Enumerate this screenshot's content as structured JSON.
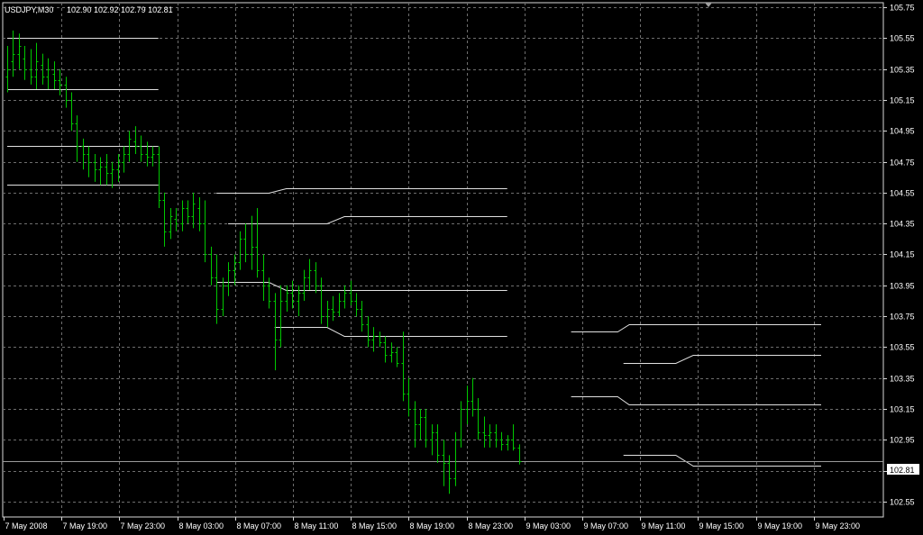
{
  "chart_data": {
    "type": "ohlc",
    "title": "USDJPY,M30",
    "ohlc_header": [
      "102.90",
      "102.92",
      "102.79",
      "102.81"
    ],
    "current_price": "102.81",
    "ylim": [
      102.45,
      105.78
    ],
    "yticks": [
      "105.75",
      "105.55",
      "105.35",
      "105.15",
      "104.95",
      "104.75",
      "104.55",
      "104.35",
      "104.15",
      "103.95",
      "103.75",
      "103.55",
      "103.35",
      "103.15",
      "102.95",
      "102.75",
      "102.55"
    ],
    "xticks": [
      "7 May 2008",
      "7 May 19:00",
      "7 May 23:00",
      "8 May 03:00",
      "8 May 07:00",
      "8 May 11:00",
      "8 May 15:00",
      "8 May 19:00",
      "8 May 23:00",
      "9 May 03:00",
      "9 May 07:00",
      "9 May 11:00",
      "9 May 15:00",
      "9 May 19:00",
      "9 May 23:00"
    ],
    "grid": true,
    "colors": {
      "background": "#000000",
      "grid": "#6e6e6e",
      "bars": "#00c800",
      "lines": "#e0e0e0",
      "axis": "#d8d8d8",
      "text": "#ffffff"
    },
    "bars": [
      {
        "o": 105.3,
        "h": 105.5,
        "l": 105.2,
        "c": 105.35
      },
      {
        "o": 105.4,
        "h": 105.6,
        "l": 105.3,
        "c": 105.45
      },
      {
        "o": 105.45,
        "h": 105.58,
        "l": 105.35,
        "c": 105.5
      },
      {
        "o": 105.42,
        "h": 105.5,
        "l": 105.28,
        "c": 105.35
      },
      {
        "o": 105.35,
        "h": 105.48,
        "l": 105.25,
        "c": 105.3
      },
      {
        "o": 105.3,
        "h": 105.52,
        "l": 105.22,
        "c": 105.4
      },
      {
        "o": 105.38,
        "h": 105.45,
        "l": 105.25,
        "c": 105.3
      },
      {
        "o": 105.3,
        "h": 105.42,
        "l": 105.22,
        "c": 105.35
      },
      {
        "o": 105.32,
        "h": 105.4,
        "l": 105.22,
        "c": 105.28
      },
      {
        "o": 105.28,
        "h": 105.35,
        "l": 105.18,
        "c": 105.25
      },
      {
        "o": 105.25,
        "h": 105.3,
        "l": 105.1,
        "c": 105.15
      },
      {
        "o": 105.15,
        "h": 105.2,
        "l": 104.95,
        "c": 105.0
      },
      {
        "o": 105.0,
        "h": 105.05,
        "l": 104.75,
        "c": 104.85
      },
      {
        "o": 104.85,
        "h": 104.9,
        "l": 104.7,
        "c": 104.8
      },
      {
        "o": 104.8,
        "h": 104.85,
        "l": 104.65,
        "c": 104.75
      },
      {
        "o": 104.75,
        "h": 104.8,
        "l": 104.62,
        "c": 104.7
      },
      {
        "o": 104.7,
        "h": 104.78,
        "l": 104.6,
        "c": 104.72
      },
      {
        "o": 104.72,
        "h": 104.8,
        "l": 104.6,
        "c": 104.68
      },
      {
        "o": 104.68,
        "h": 104.75,
        "l": 104.58,
        "c": 104.7
      },
      {
        "o": 104.7,
        "h": 104.8,
        "l": 104.62,
        "c": 104.75
      },
      {
        "o": 104.75,
        "h": 104.85,
        "l": 104.68,
        "c": 104.8
      },
      {
        "o": 104.8,
        "h": 104.95,
        "l": 104.75,
        "c": 104.9
      },
      {
        "o": 104.88,
        "h": 104.98,
        "l": 104.8,
        "c": 104.85
      },
      {
        "o": 104.85,
        "h": 104.92,
        "l": 104.75,
        "c": 104.8
      },
      {
        "o": 104.8,
        "h": 104.88,
        "l": 104.72,
        "c": 104.78
      },
      {
        "o": 104.78,
        "h": 104.85,
        "l": 104.72,
        "c": 104.8
      },
      {
        "o": 104.8,
        "h": 104.85,
        "l": 104.45,
        "c": 104.5
      },
      {
        "o": 104.5,
        "h": 104.55,
        "l": 104.2,
        "c": 104.3
      },
      {
        "o": 104.3,
        "h": 104.45,
        "l": 104.25,
        "c": 104.4
      },
      {
        "o": 104.38,
        "h": 104.45,
        "l": 104.3,
        "c": 104.35
      },
      {
        "o": 104.35,
        "h": 104.5,
        "l": 104.3,
        "c": 104.45
      },
      {
        "o": 104.45,
        "h": 104.5,
        "l": 104.35,
        "c": 104.4
      },
      {
        "o": 104.4,
        "h": 104.55,
        "l": 104.32,
        "c": 104.48
      },
      {
        "o": 104.45,
        "h": 104.52,
        "l": 104.3,
        "c": 104.35
      },
      {
        "o": 104.35,
        "h": 104.5,
        "l": 104.1,
        "c": 104.15
      },
      {
        "o": 104.15,
        "h": 104.2,
        "l": 103.95,
        "c": 104.0
      },
      {
        "o": 104.0,
        "h": 104.15,
        "l": 103.7,
        "c": 103.8
      },
      {
        "o": 103.8,
        "h": 104.0,
        "l": 103.75,
        "c": 103.95
      },
      {
        "o": 103.95,
        "h": 104.1,
        "l": 103.88,
        "c": 104.05
      },
      {
        "o": 104.05,
        "h": 104.15,
        "l": 103.95,
        "c": 104.1
      },
      {
        "o": 104.1,
        "h": 104.3,
        "l": 104.05,
        "c": 104.25
      },
      {
        "o": 104.25,
        "h": 104.35,
        "l": 104.1,
        "c": 104.15
      },
      {
        "o": 104.15,
        "h": 104.4,
        "l": 104.05,
        "c": 104.2
      },
      {
        "o": 104.2,
        "h": 104.45,
        "l": 104.0,
        "c": 104.05
      },
      {
        "o": 104.05,
        "h": 104.15,
        "l": 103.85,
        "c": 103.95
      },
      {
        "o": 103.95,
        "h": 104.0,
        "l": 103.8,
        "c": 103.85
      },
      {
        "o": 103.85,
        "h": 103.9,
        "l": 103.4,
        "c": 103.6
      },
      {
        "o": 103.6,
        "h": 103.95,
        "l": 103.55,
        "c": 103.85
      },
      {
        "o": 103.85,
        "h": 103.95,
        "l": 103.78,
        "c": 103.9
      },
      {
        "o": 103.9,
        "h": 103.98,
        "l": 103.8,
        "c": 103.85
      },
      {
        "o": 103.85,
        "h": 103.95,
        "l": 103.75,
        "c": 103.9
      },
      {
        "o": 103.9,
        "h": 104.05,
        "l": 103.85,
        "c": 104.0
      },
      {
        "o": 104.0,
        "h": 104.12,
        "l": 103.92,
        "c": 104.05
      },
      {
        "o": 104.05,
        "h": 104.1,
        "l": 103.9,
        "c": 103.95
      },
      {
        "o": 103.95,
        "h": 104.0,
        "l": 103.7,
        "c": 103.75
      },
      {
        "o": 103.75,
        "h": 103.85,
        "l": 103.68,
        "c": 103.8
      },
      {
        "o": 103.8,
        "h": 103.88,
        "l": 103.72,
        "c": 103.78
      },
      {
        "o": 103.78,
        "h": 103.9,
        "l": 103.75,
        "c": 103.85
      },
      {
        "o": 103.85,
        "h": 103.95,
        "l": 103.8,
        "c": 103.9
      },
      {
        "o": 103.9,
        "h": 103.98,
        "l": 103.82,
        "c": 103.85
      },
      {
        "o": 103.85,
        "h": 103.9,
        "l": 103.75,
        "c": 103.8
      },
      {
        "o": 103.8,
        "h": 103.85,
        "l": 103.65,
        "c": 103.7
      },
      {
        "o": 103.7,
        "h": 103.75,
        "l": 103.55,
        "c": 103.6
      },
      {
        "o": 103.6,
        "h": 103.68,
        "l": 103.52,
        "c": 103.62
      },
      {
        "o": 103.62,
        "h": 103.65,
        "l": 103.55,
        "c": 103.58
      },
      {
        "o": 103.58,
        "h": 103.62,
        "l": 103.45,
        "c": 103.5
      },
      {
        "o": 103.5,
        "h": 103.58,
        "l": 103.45,
        "c": 103.52
      },
      {
        "o": 103.52,
        "h": 103.55,
        "l": 103.42,
        "c": 103.45
      },
      {
        "o": 103.45,
        "h": 103.65,
        "l": 103.2,
        "c": 103.25
      },
      {
        "o": 103.25,
        "h": 103.35,
        "l": 103.1,
        "c": 103.15
      },
      {
        "o": 103.15,
        "h": 103.2,
        "l": 102.9,
        "c": 103.05
      },
      {
        "o": 103.05,
        "h": 103.15,
        "l": 102.95,
        "c": 103.1
      },
      {
        "o": 103.1,
        "h": 103.15,
        "l": 102.9,
        "c": 102.95
      },
      {
        "o": 102.95,
        "h": 103.05,
        "l": 102.85,
        "c": 103.0
      },
      {
        "o": 103.0,
        "h": 103.05,
        "l": 102.8,
        "c": 102.85
      },
      {
        "o": 102.85,
        "h": 102.95,
        "l": 102.65,
        "c": 102.8
      },
      {
        "o": 102.8,
        "h": 102.85,
        "l": 102.6,
        "c": 102.7
      },
      {
        "o": 102.7,
        "h": 103.0,
        "l": 102.65,
        "c": 102.95
      },
      {
        "o": 102.95,
        "h": 103.2,
        "l": 102.9,
        "c": 103.15
      },
      {
        "o": 103.15,
        "h": 103.3,
        "l": 103.05,
        "c": 103.2
      },
      {
        "o": 103.2,
        "h": 103.35,
        "l": 103.1,
        "c": 103.15
      },
      {
        "o": 103.15,
        "h": 103.22,
        "l": 102.95,
        "c": 103.0
      },
      {
        "o": 103.0,
        "h": 103.1,
        "l": 102.9,
        "c": 102.98
      },
      {
        "o": 102.98,
        "h": 103.05,
        "l": 102.9,
        "c": 103.0
      },
      {
        "o": 103.0,
        "h": 103.05,
        "l": 102.9,
        "c": 102.95
      },
      {
        "o": 102.95,
        "h": 103.0,
        "l": 102.88,
        "c": 102.92
      },
      {
        "o": 102.92,
        "h": 102.98,
        "l": 102.88,
        "c": 102.95
      },
      {
        "o": 102.95,
        "h": 103.05,
        "l": 102.88,
        "c": 102.9
      },
      {
        "o": 102.9,
        "h": 102.92,
        "l": 102.79,
        "c": 102.81
      }
    ],
    "level_lines": [
      {
        "points": [
          [
            0,
            105.55
          ],
          [
            26,
            105.55
          ]
        ]
      },
      {
        "points": [
          [
            0,
            105.22
          ],
          [
            26,
            105.22
          ]
        ]
      },
      {
        "points": [
          [
            0,
            104.85
          ],
          [
            26,
            104.85
          ]
        ]
      },
      {
        "points": [
          [
            0,
            104.6
          ],
          [
            26,
            104.6
          ]
        ]
      },
      {
        "points": [
          [
            36,
            104.55
          ],
          [
            45,
            104.55
          ],
          [
            48,
            104.58
          ],
          [
            86,
            104.58
          ]
        ]
      },
      {
        "points": [
          [
            38,
            104.35
          ],
          [
            55,
            104.35
          ],
          [
            58,
            104.4
          ],
          [
            86,
            104.4
          ]
        ]
      },
      {
        "points": [
          [
            36,
            103.97
          ],
          [
            45,
            103.97
          ],
          [
            48,
            103.92
          ],
          [
            86,
            103.92
          ]
        ]
      },
      {
        "points": [
          [
            46,
            103.68
          ],
          [
            55,
            103.68
          ],
          [
            58,
            103.62
          ],
          [
            86,
            103.62
          ]
        ]
      },
      {
        "points": [
          [
            97,
            103.65
          ],
          [
            105,
            103.65
          ],
          [
            107,
            103.7
          ],
          [
            140,
            103.7
          ]
        ]
      },
      {
        "points": [
          [
            106,
            103.45
          ],
          [
            115,
            103.45
          ],
          [
            118,
            103.5
          ],
          [
            140,
            103.5
          ]
        ]
      },
      {
        "points": [
          [
            97,
            103.23
          ],
          [
            105,
            103.23
          ],
          [
            107,
            103.18
          ],
          [
            140,
            103.18
          ]
        ]
      },
      {
        "points": [
          [
            106,
            102.85
          ],
          [
            115,
            102.85
          ],
          [
            118,
            102.78
          ],
          [
            140,
            102.78
          ]
        ]
      }
    ]
  }
}
